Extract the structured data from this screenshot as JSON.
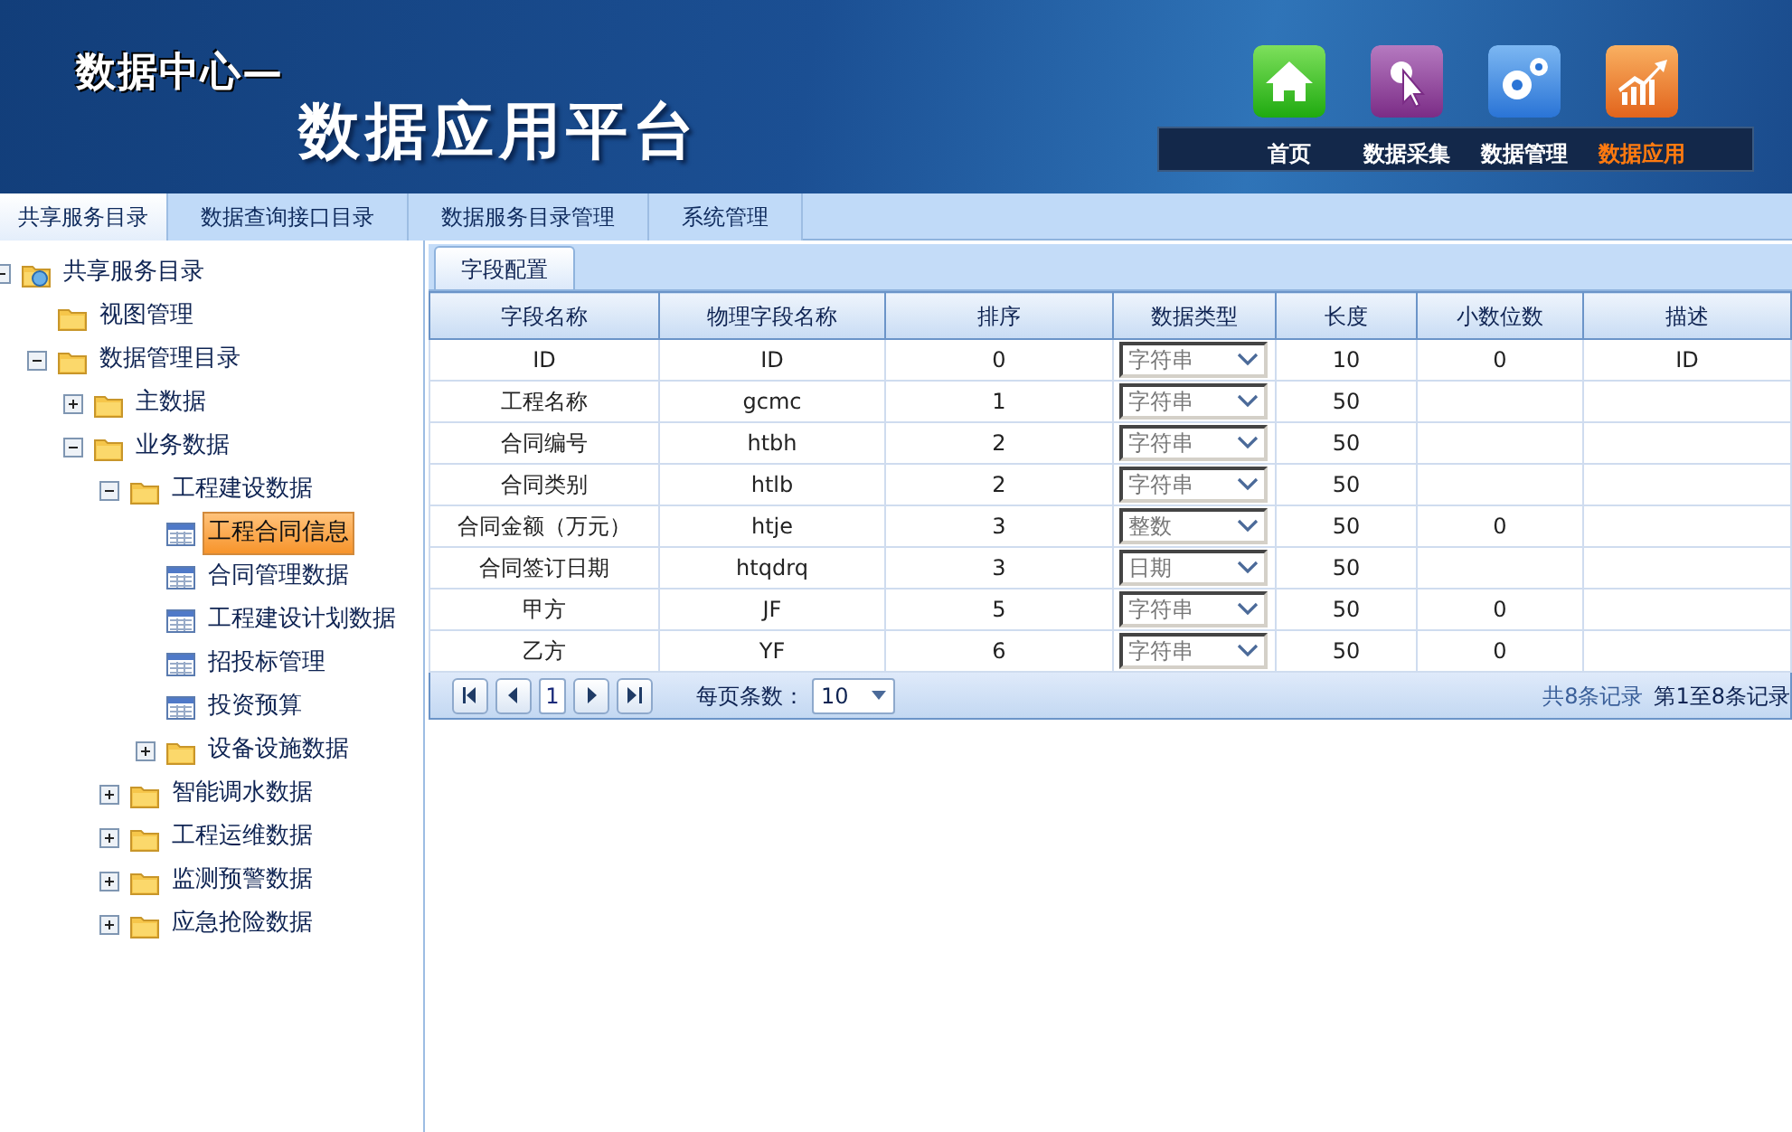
{
  "header": {
    "subtitle": "数据中心—",
    "title": "数据应用平台"
  },
  "nav": [
    {
      "label": "首页",
      "selected": false
    },
    {
      "label": "数据采集",
      "selected": false
    },
    {
      "label": "数据管理",
      "selected": false
    },
    {
      "label": "数据应用",
      "selected": true
    }
  ],
  "tabs": [
    {
      "label": "共享服务目录",
      "selected": true
    },
    {
      "label": "数据查询接口目录",
      "selected": false
    },
    {
      "label": "数据服务目录管理",
      "selected": false
    },
    {
      "label": "系统管理",
      "selected": false
    }
  ],
  "tree": [
    {
      "label": "共享服务目录",
      "kind": "root",
      "expanded": true,
      "selected": false,
      "children": [
        {
          "label": "视图管理",
          "kind": "folder",
          "selected": false
        },
        {
          "label": "数据管理目录",
          "kind": "folder",
          "expanded": true,
          "selected": false,
          "children": [
            {
              "label": "主数据",
              "kind": "folder",
              "expanded": false,
              "selected": false
            },
            {
              "label": "业务数据",
              "kind": "folder",
              "expanded": true,
              "selected": false,
              "children": [
                {
                  "label": "工程建设数据",
                  "kind": "folder",
                  "expanded": true,
                  "selected": false,
                  "children": [
                    {
                      "label": "工程合同信息",
                      "kind": "table",
                      "selected": true
                    },
                    {
                      "label": "合同管理数据",
                      "kind": "table",
                      "selected": false
                    },
                    {
                      "label": "工程建设计划数据",
                      "kind": "table",
                      "selected": false
                    },
                    {
                      "label": "招投标管理",
                      "kind": "table",
                      "selected": false
                    },
                    {
                      "label": "投资预算",
                      "kind": "table",
                      "selected": false
                    },
                    {
                      "label": "设备设施数据",
                      "kind": "folder",
                      "expanded": false,
                      "selected": false
                    }
                  ]
                },
                {
                  "label": "智能调水数据",
                  "kind": "folder",
                  "expanded": false,
                  "selected": false
                },
                {
                  "label": "工程运维数据",
                  "kind": "folder",
                  "expanded": false,
                  "selected": false
                },
                {
                  "label": "监测预警数据",
                  "kind": "folder",
                  "expanded": false,
                  "selected": false
                },
                {
                  "label": "应急抢险数据",
                  "kind": "folder",
                  "expanded": false,
                  "selected": false
                }
              ]
            }
          ]
        }
      ]
    }
  ],
  "panel_tab": {
    "label": "字段配置",
    "selected": true
  },
  "table": {
    "columns": [
      "字段名称",
      "物理字段名称",
      "排序",
      "数据类型",
      "长度",
      "小数位数",
      "描述"
    ],
    "rows": [
      {
        "name": "ID",
        "physical": "ID",
        "order": "0",
        "type": "字符串",
        "length": "10",
        "scale": "0",
        "description": "ID"
      },
      {
        "name": "工程名称",
        "physical": "gcmc",
        "order": "1",
        "type": "字符串",
        "length": "50"
      },
      {
        "name": "合同编号",
        "physical": "htbh",
        "order": "2",
        "type": "字符串",
        "length": "50"
      },
      {
        "name": "合同类别",
        "physical": "htlb",
        "order": "2",
        "type": "字符串",
        "length": "50"
      },
      {
        "name": "合同金额（万元）",
        "physical": "htje",
        "order": "3",
        "type": "整数",
        "length": "50",
        "scale": "0"
      },
      {
        "name": "合同签订日期",
        "physical": "htqdrq",
        "order": "3",
        "type": "日期",
        "length": "50"
      },
      {
        "name": "甲方",
        "physical": "JF",
        "order": "5",
        "type": "字符串",
        "length": "50",
        "scale": "0"
      },
      {
        "name": "乙方",
        "physical": "YF",
        "order": "6",
        "type": "字符串",
        "length": "50",
        "scale": "0"
      }
    ]
  },
  "pager": {
    "page": "1",
    "page_size_label": "每页条数：",
    "page_size": "10",
    "total": "共8条记录",
    "range": "第1至8条记录"
  }
}
